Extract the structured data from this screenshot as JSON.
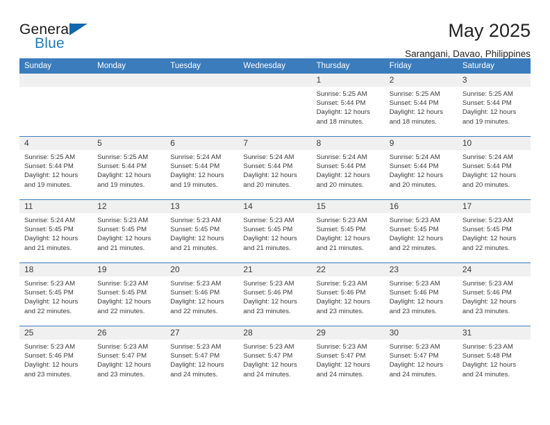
{
  "brand": {
    "name_part1": "General",
    "name_part2": "Blue",
    "flag_color": "#1268ad",
    "blue_color": "#1f7ac0"
  },
  "header": {
    "title": "May 2025",
    "subtitle": "Sarangani, Davao, Philippines"
  },
  "theme": {
    "header_row_bg": "#3b7cbd",
    "daynum_bg": "#f0f0f0",
    "text": "#3a3a3a"
  },
  "weekdays": [
    "Sunday",
    "Monday",
    "Tuesday",
    "Wednesday",
    "Thursday",
    "Friday",
    "Saturday"
  ],
  "labels": {
    "sunrise_prefix": "Sunrise: ",
    "sunset_prefix": "Sunset: ",
    "daylight_prefix": "Daylight: "
  },
  "weeks": [
    [
      {
        "day": "",
        "empty": true
      },
      {
        "day": "",
        "empty": true
      },
      {
        "day": "",
        "empty": true
      },
      {
        "day": "",
        "empty": true
      },
      {
        "day": "1",
        "sunrise": "Sunrise: 5:25 AM",
        "sunset": "Sunset: 5:44 PM",
        "daylight_l1": "Daylight: 12 hours",
        "daylight_l2": "and 18 minutes."
      },
      {
        "day": "2",
        "sunrise": "Sunrise: 5:25 AM",
        "sunset": "Sunset: 5:44 PM",
        "daylight_l1": "Daylight: 12 hours",
        "daylight_l2": "and 18 minutes."
      },
      {
        "day": "3",
        "sunrise": "Sunrise: 5:25 AM",
        "sunset": "Sunset: 5:44 PM",
        "daylight_l1": "Daylight: 12 hours",
        "daylight_l2": "and 19 minutes."
      }
    ],
    [
      {
        "day": "4",
        "sunrise": "Sunrise: 5:25 AM",
        "sunset": "Sunset: 5:44 PM",
        "daylight_l1": "Daylight: 12 hours",
        "daylight_l2": "and 19 minutes."
      },
      {
        "day": "5",
        "sunrise": "Sunrise: 5:25 AM",
        "sunset": "Sunset: 5:44 PM",
        "daylight_l1": "Daylight: 12 hours",
        "daylight_l2": "and 19 minutes."
      },
      {
        "day": "6",
        "sunrise": "Sunrise: 5:24 AM",
        "sunset": "Sunset: 5:44 PM",
        "daylight_l1": "Daylight: 12 hours",
        "daylight_l2": "and 19 minutes."
      },
      {
        "day": "7",
        "sunrise": "Sunrise: 5:24 AM",
        "sunset": "Sunset: 5:44 PM",
        "daylight_l1": "Daylight: 12 hours",
        "daylight_l2": "and 20 minutes."
      },
      {
        "day": "8",
        "sunrise": "Sunrise: 5:24 AM",
        "sunset": "Sunset: 5:44 PM",
        "daylight_l1": "Daylight: 12 hours",
        "daylight_l2": "and 20 minutes."
      },
      {
        "day": "9",
        "sunrise": "Sunrise: 5:24 AM",
        "sunset": "Sunset: 5:44 PM",
        "daylight_l1": "Daylight: 12 hours",
        "daylight_l2": "and 20 minutes."
      },
      {
        "day": "10",
        "sunrise": "Sunrise: 5:24 AM",
        "sunset": "Sunset: 5:44 PM",
        "daylight_l1": "Daylight: 12 hours",
        "daylight_l2": "and 20 minutes."
      }
    ],
    [
      {
        "day": "11",
        "sunrise": "Sunrise: 5:24 AM",
        "sunset": "Sunset: 5:45 PM",
        "daylight_l1": "Daylight: 12 hours",
        "daylight_l2": "and 21 minutes."
      },
      {
        "day": "12",
        "sunrise": "Sunrise: 5:23 AM",
        "sunset": "Sunset: 5:45 PM",
        "daylight_l1": "Daylight: 12 hours",
        "daylight_l2": "and 21 minutes."
      },
      {
        "day": "13",
        "sunrise": "Sunrise: 5:23 AM",
        "sunset": "Sunset: 5:45 PM",
        "daylight_l1": "Daylight: 12 hours",
        "daylight_l2": "and 21 minutes."
      },
      {
        "day": "14",
        "sunrise": "Sunrise: 5:23 AM",
        "sunset": "Sunset: 5:45 PM",
        "daylight_l1": "Daylight: 12 hours",
        "daylight_l2": "and 21 minutes."
      },
      {
        "day": "15",
        "sunrise": "Sunrise: 5:23 AM",
        "sunset": "Sunset: 5:45 PM",
        "daylight_l1": "Daylight: 12 hours",
        "daylight_l2": "and 21 minutes."
      },
      {
        "day": "16",
        "sunrise": "Sunrise: 5:23 AM",
        "sunset": "Sunset: 5:45 PM",
        "daylight_l1": "Daylight: 12 hours",
        "daylight_l2": "and 22 minutes."
      },
      {
        "day": "17",
        "sunrise": "Sunrise: 5:23 AM",
        "sunset": "Sunset: 5:45 PM",
        "daylight_l1": "Daylight: 12 hours",
        "daylight_l2": "and 22 minutes."
      }
    ],
    [
      {
        "day": "18",
        "sunrise": "Sunrise: 5:23 AM",
        "sunset": "Sunset: 5:45 PM",
        "daylight_l1": "Daylight: 12 hours",
        "daylight_l2": "and 22 minutes."
      },
      {
        "day": "19",
        "sunrise": "Sunrise: 5:23 AM",
        "sunset": "Sunset: 5:45 PM",
        "daylight_l1": "Daylight: 12 hours",
        "daylight_l2": "and 22 minutes."
      },
      {
        "day": "20",
        "sunrise": "Sunrise: 5:23 AM",
        "sunset": "Sunset: 5:46 PM",
        "daylight_l1": "Daylight: 12 hours",
        "daylight_l2": "and 22 minutes."
      },
      {
        "day": "21",
        "sunrise": "Sunrise: 5:23 AM",
        "sunset": "Sunset: 5:46 PM",
        "daylight_l1": "Daylight: 12 hours",
        "daylight_l2": "and 23 minutes."
      },
      {
        "day": "22",
        "sunrise": "Sunrise: 5:23 AM",
        "sunset": "Sunset: 5:46 PM",
        "daylight_l1": "Daylight: 12 hours",
        "daylight_l2": "and 23 minutes."
      },
      {
        "day": "23",
        "sunrise": "Sunrise: 5:23 AM",
        "sunset": "Sunset: 5:46 PM",
        "daylight_l1": "Daylight: 12 hours",
        "daylight_l2": "and 23 minutes."
      },
      {
        "day": "24",
        "sunrise": "Sunrise: 5:23 AM",
        "sunset": "Sunset: 5:46 PM",
        "daylight_l1": "Daylight: 12 hours",
        "daylight_l2": "and 23 minutes."
      }
    ],
    [
      {
        "day": "25",
        "sunrise": "Sunrise: 5:23 AM",
        "sunset": "Sunset: 5:46 PM",
        "daylight_l1": "Daylight: 12 hours",
        "daylight_l2": "and 23 minutes."
      },
      {
        "day": "26",
        "sunrise": "Sunrise: 5:23 AM",
        "sunset": "Sunset: 5:47 PM",
        "daylight_l1": "Daylight: 12 hours",
        "daylight_l2": "and 23 minutes."
      },
      {
        "day": "27",
        "sunrise": "Sunrise: 5:23 AM",
        "sunset": "Sunset: 5:47 PM",
        "daylight_l1": "Daylight: 12 hours",
        "daylight_l2": "and 24 minutes."
      },
      {
        "day": "28",
        "sunrise": "Sunrise: 5:23 AM",
        "sunset": "Sunset: 5:47 PM",
        "daylight_l1": "Daylight: 12 hours",
        "daylight_l2": "and 24 minutes."
      },
      {
        "day": "29",
        "sunrise": "Sunrise: 5:23 AM",
        "sunset": "Sunset: 5:47 PM",
        "daylight_l1": "Daylight: 12 hours",
        "daylight_l2": "and 24 minutes."
      },
      {
        "day": "30",
        "sunrise": "Sunrise: 5:23 AM",
        "sunset": "Sunset: 5:47 PM",
        "daylight_l1": "Daylight: 12 hours",
        "daylight_l2": "and 24 minutes."
      },
      {
        "day": "31",
        "sunrise": "Sunrise: 5:23 AM",
        "sunset": "Sunset: 5:48 PM",
        "daylight_l1": "Daylight: 12 hours",
        "daylight_l2": "and 24 minutes."
      }
    ]
  ]
}
